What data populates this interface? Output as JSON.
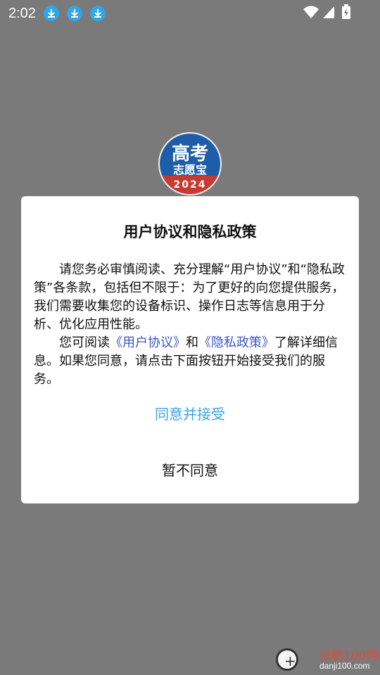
{
  "status_bar": {
    "time": "2:02",
    "icons": [
      "download-icon",
      "download-icon",
      "download-icon",
      "wifi-icon",
      "signal-icon",
      "battery-charging-icon"
    ]
  },
  "splash": {
    "logo_line1": "高考",
    "logo_line2": "志愿宝",
    "logo_year": "2024"
  },
  "dialog": {
    "title": "用户协议和隐私政策",
    "para1": "请您务必审慎阅读、充分理解“用户协议”和“隐私政策”各条款，包括但不限于：为了更好的向您提供服务，我们需要收集您的设备标识、操作日志等信息用于分析、优化应用性能。",
    "para2_prefix": "您可阅读",
    "link_user_agreement": "《用户协议》",
    "para2_and": "和",
    "link_privacy_policy": "《隐私政策》",
    "para2_suffix": "了解详细信息。如果您同意，请点击下面按钮开始接受我们的服务。",
    "accept_label": "同意并接受",
    "decline_label": "暂不同意"
  },
  "watermark": {
    "name": "单机100网",
    "url": "danji100.com"
  },
  "colors": {
    "overlay": "#7a7a7a",
    "accept": "#3aa3e0",
    "link": "#3a57c8",
    "download_badge": "#2fa7e8"
  }
}
